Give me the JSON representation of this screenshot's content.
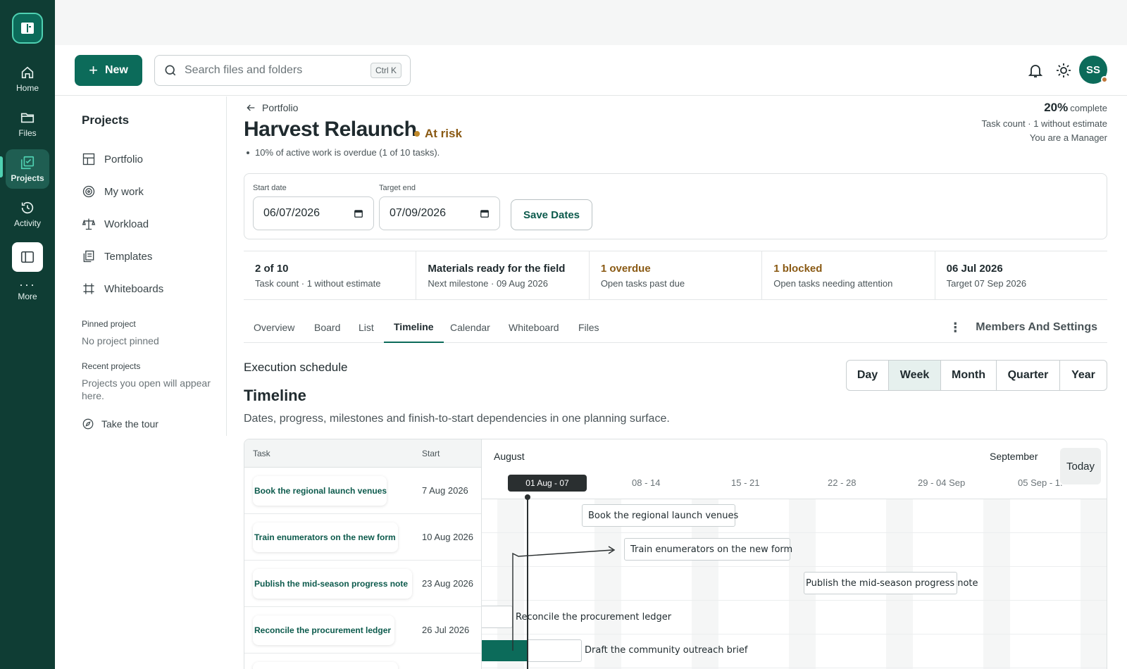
{
  "rail": {
    "items": [
      {
        "label": "Home",
        "icon": "home-icon"
      },
      {
        "label": "Files",
        "icon": "folder-icon"
      },
      {
        "label": "Projects",
        "icon": "projects-icon",
        "active": true
      },
      {
        "label": "Activity",
        "icon": "history-icon"
      }
    ],
    "more_label": "More"
  },
  "header": {
    "new_label": "New",
    "search_placeholder": "Search files and folders",
    "search_shortcut": "Ctrl K",
    "avatar_initials": "SS"
  },
  "subnav": {
    "title": "Projects",
    "items": [
      {
        "label": "Portfolio",
        "icon": "grid-icon"
      },
      {
        "label": "My work",
        "icon": "target-icon"
      },
      {
        "label": "Workload",
        "icon": "scale-icon"
      },
      {
        "label": "Templates",
        "icon": "templates-icon"
      },
      {
        "label": "Whiteboards",
        "icon": "frame-icon"
      }
    ],
    "pinned_label": "Pinned project",
    "pinned_value": "No project pinned",
    "recent_label": "Recent projects",
    "recent_value": "Projects you open will appear here.",
    "tour_label": "Take the tour"
  },
  "project": {
    "breadcrumb": "Portfolio",
    "title": "Harvest Relaunch",
    "status": "At risk",
    "overdue_note": "10% of active work is overdue (1 of 10 tasks).",
    "progress_pct": "20%",
    "progress_label": "complete",
    "progress_line1": "Task count · 1 without estimate",
    "progress_line2": "You are a Manager"
  },
  "dates": {
    "start_label": "Start date",
    "start_value": "06/07/2026",
    "end_label": "Target end",
    "end_value": "07/09/2026",
    "save_label": "Save Dates"
  },
  "stats": [
    {
      "title": "2 of 10",
      "sub": "Task count · 1 without estimate",
      "tone": "normal"
    },
    {
      "title": "Materials ready for the field",
      "sub": "Next milestone · 09 Aug 2026",
      "tone": "normal"
    },
    {
      "title": "1 overdue",
      "sub": "Open tasks past due",
      "tone": "warn"
    },
    {
      "title": "1 blocked",
      "sub": "Open tasks needing attention",
      "tone": "warn"
    },
    {
      "title": "06 Jul 2026",
      "sub": "Target 07 Sep 2026",
      "tone": "normal"
    }
  ],
  "tabs": [
    "Overview",
    "Board",
    "List",
    "Timeline",
    "Calendar",
    "Whiteboard",
    "Files"
  ],
  "active_tab": "Timeline",
  "members_label": "Members And Settings",
  "timeline": {
    "eyebrow": "Execution schedule",
    "title": "Timeline",
    "description": "Dates, progress, milestones and finish-to-start dependencies in one planning surface.",
    "scales": [
      "Day",
      "Week",
      "Month",
      "Quarter",
      "Year"
    ],
    "active_scale": "Week",
    "col_task": "Task",
    "col_start": "Start",
    "month_1": "August",
    "month_2": "September",
    "today_label": "Today",
    "weeks": [
      "01 Aug - 07",
      "08 - 14",
      "15 - 21",
      "22 - 28",
      "29 - 04 Sep",
      "05 Sep - 1."
    ],
    "tasks": [
      {
        "name": "Book the regional launch venues",
        "start": "7 Aug 2026"
      },
      {
        "name": "Train enumerators on the new form",
        "start": "10 Aug 2026"
      },
      {
        "name": "Publish the mid-season progress note",
        "start": "23 Aug 2026"
      },
      {
        "name": "Reconcile the procurement ledger",
        "start": "26 Jul 2026"
      }
    ],
    "bars": [
      "Book the regional launch venues",
      "Train enumerators on the new form",
      "Publish the mid-season progress note",
      "Reconcile the procurement ledger",
      "Draft the community outreach brief"
    ]
  }
}
